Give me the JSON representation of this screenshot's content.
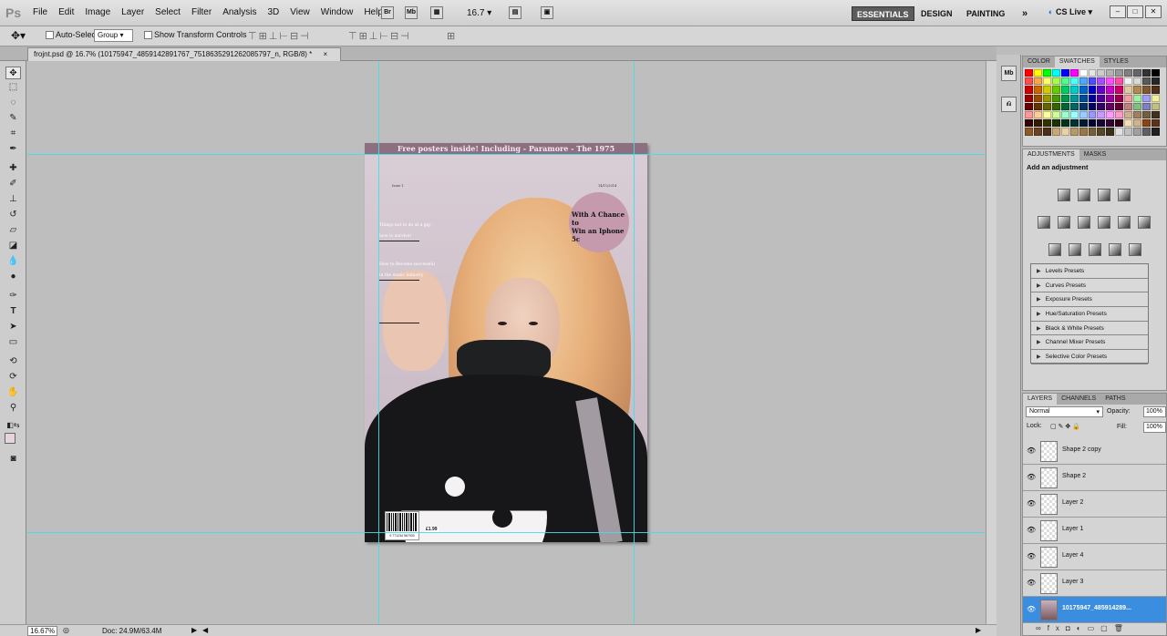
{
  "app": {
    "logo": "Ps"
  },
  "menu": [
    "File",
    "Edit",
    "Image",
    "Layer",
    "Select",
    "Filter",
    "Analysis",
    "3D",
    "View",
    "Window",
    "Help"
  ],
  "menubar": {
    "bridge_icon": "Br",
    "minibridge_icon": "Mb",
    "zoom_value": "16.7",
    "workspaces": {
      "essentials": "ESSENTIALS",
      "design": "DESIGN",
      "painting": "PAINTING",
      "more": "»"
    },
    "cslive": "CS Live"
  },
  "options_bar": {
    "auto_select_label": "Auto-Select:",
    "auto_select_value": "Group",
    "transform_label": "Show Transform Controls"
  },
  "document": {
    "tab_title": "frojnt.psd @ 16.7% (10175947_4859142891767_7518635291262085797_n, RGB/8) *",
    "close_glyph": "×",
    "zoom_status": "16.67%",
    "doc_info": "Doc: 24.9M/63.4M"
  },
  "poster": {
    "banner": "Free posters inside! Including - Paramore - The 1975",
    "issue": "Issue 1",
    "date": "14/11/2014",
    "circle_text_1": "With A Chance to",
    "circle_text_2": "Win an Iphone 5c",
    "cover_line_1": "Things not to do at a gig -",
    "cover_line_2": "how to survive!",
    "cover_line_3": "How to Become successful",
    "cover_line_4": "in the music industry",
    "price": "£1.99",
    "barcode_number": "9 771234 567003"
  },
  "panels": {
    "swatch_tabs": [
      "COLOR",
      "SWATCHES",
      "STYLES"
    ],
    "adjust_tabs": [
      "ADJUSTMENTS",
      "MASKS"
    ],
    "adjust_title": "Add an adjustment",
    "presets": [
      "Levels Presets",
      "Curves Presets",
      "Exposure Presets",
      "Hue/Saturation Presets",
      "Black & White Presets",
      "Channel Mixer Presets",
      "Selective Color Presets"
    ],
    "layer_tabs": [
      "LAYERS",
      "CHANNELS",
      "PATHS"
    ],
    "blend_mode": "Normal",
    "opacity_label": "Opacity:",
    "opacity_value": "100%",
    "lock_label": "Lock:",
    "fill_label": "Fill:",
    "fill_value": "100%",
    "layers": [
      "Shape 2 copy",
      "Shape 2",
      "Layer 2",
      "Layer 1",
      "Layer 4",
      "Layer 3",
      "10175947_485914289..."
    ]
  },
  "colors": {
    "accent": "#3b8de0",
    "guide": "#3fe0e6",
    "banner": "#8d6f80",
    "circle": "#c49aac"
  }
}
